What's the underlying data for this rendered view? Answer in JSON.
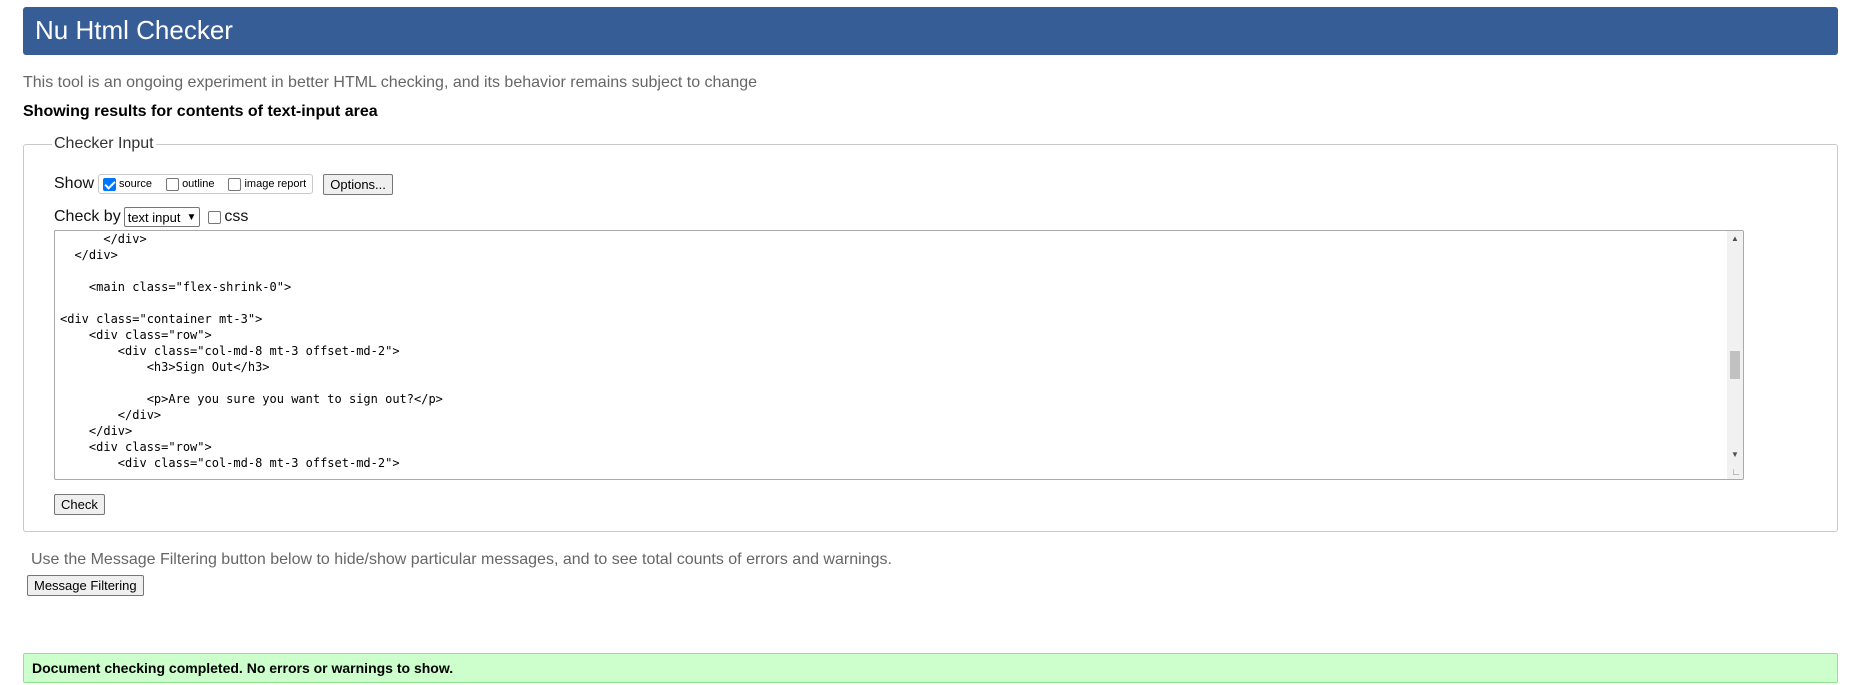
{
  "header": {
    "title": "Nu Html Checker"
  },
  "intro_text": "This tool is an ongoing experiment in better HTML checking, and its behavior remains subject to change",
  "results_heading": "Showing results for contents of text-input area",
  "checker_input": {
    "legend": "Checker Input",
    "show_label": "Show",
    "show_options": [
      {
        "label": "source",
        "checked": true
      },
      {
        "label": "outline",
        "checked": false
      },
      {
        "label": "image report",
        "checked": false
      }
    ],
    "options_button": "Options...",
    "check_by_label": "Check by",
    "check_by_selected": "text input",
    "css_label": "css",
    "css_checked": false,
    "code_lines": [
      "      </div>",
      "  </div>",
      "",
      "    <main class=\"flex-shrink-0\">",
      "",
      "<div class=\"container mt-3\">",
      "    <div class=\"row\">",
      "        <div class=\"col-md-8 mt-3 offset-md-2\">",
      "            <h3>Sign Out</h3>",
      "",
      "            <p>Are you sure you want to sign out?</p>",
      "        </div>",
      "    </div>",
      "    <div class=\"row\">",
      "        <div class=\"col-md-8 mt-3 offset-md-2\">"
    ],
    "check_button": "Check"
  },
  "filter_text": "Use the Message Filtering button below to hide/show particular messages, and to see total counts of errors and warnings.",
  "filter_button": "Message Filtering",
  "success_message": "Document checking completed. No errors or warnings to show.",
  "colors": {
    "header_bg": "#365d95",
    "success_bg": "#ccffcc",
    "checkbox_accent": "#0075ff"
  }
}
